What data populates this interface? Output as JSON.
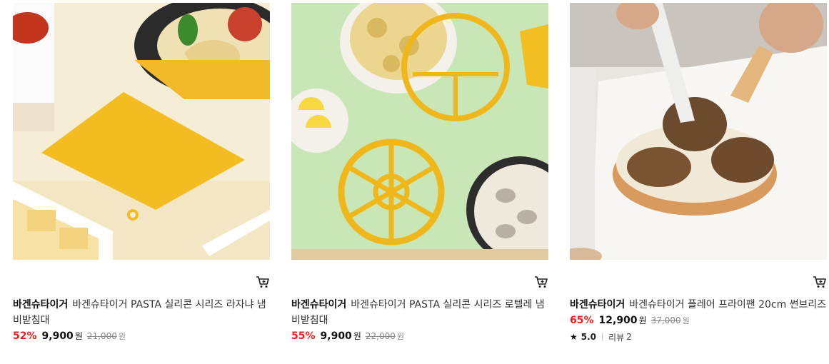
{
  "products": [
    {
      "image_alt": "",
      "brand": "바겐슈타이거",
      "name": "바겐슈타이거 PASTA 실리콘 시리즈 라자냐 냄비받침대",
      "discount": "52%",
      "price": "9,900",
      "price_unit": "원",
      "original_price": "21,000",
      "original_unit": "원",
      "cart_icon": "cart-icon"
    },
    {
      "image_alt": "",
      "brand": "바겐슈타이거",
      "name": "바겐슈타이거 PASTA 실리콘 시리즈 로텔레 냄비받침대",
      "discount": "55%",
      "price": "9,900",
      "price_unit": "원",
      "original_price": "22,000",
      "original_unit": "원",
      "cart_icon": "cart-icon"
    },
    {
      "image_alt": "",
      "brand": "바겐슈타이거",
      "name": "바겐슈타이거 플레어 프라이팬 20cm 썬브리즈",
      "discount": "65%",
      "price": "12,900",
      "price_unit": "원",
      "original_price": "37,000",
      "original_unit": "원",
      "rating": "5.0",
      "review_label": "리뷰",
      "review_count": "2",
      "cart_icon": "cart-icon"
    }
  ],
  "colors": {
    "discount": "#e1251b",
    "strike": "#888888"
  }
}
